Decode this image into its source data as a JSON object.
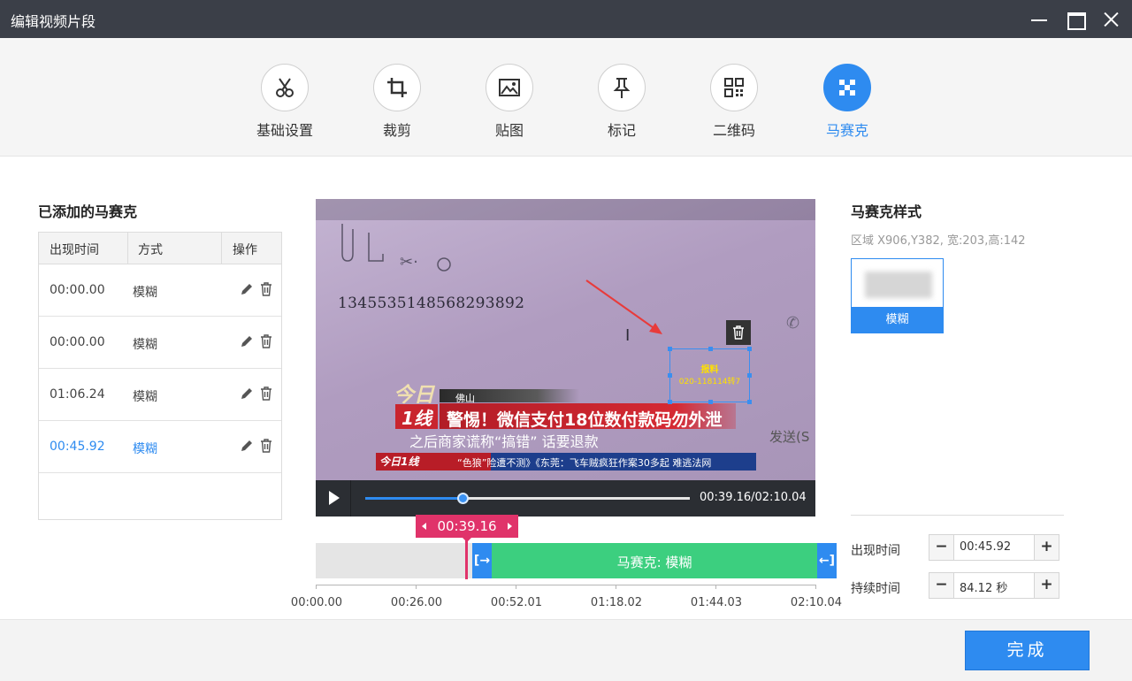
{
  "window": {
    "title": "编辑视频片段"
  },
  "toolbar": {
    "tools": [
      {
        "label": "基础设置",
        "icon": "scissors-icon"
      },
      {
        "label": "裁剪",
        "icon": "crop-icon"
      },
      {
        "label": "贴图",
        "icon": "image-icon"
      },
      {
        "label": "标记",
        "icon": "pin-icon"
      },
      {
        "label": "二维码",
        "icon": "qrcode-icon"
      },
      {
        "label": "马赛克",
        "icon": "mosaic-icon",
        "active": true
      }
    ]
  },
  "added": {
    "title": "已添加的马赛克",
    "headers": [
      "出现时间",
      "方式",
      "操作"
    ],
    "rows": [
      {
        "time": "00:00.00",
        "mode": "模糊"
      },
      {
        "time": "00:00.00",
        "mode": "模糊"
      },
      {
        "time": "01:06.24",
        "mode": "模糊"
      },
      {
        "time": "00:45.92",
        "mode": "模糊",
        "active": true
      }
    ]
  },
  "video": {
    "number_text": "13455351485682938​92",
    "selection_line1": "报料",
    "selection_line2": "020-118114转7",
    "city": "佛山",
    "logo_a": "今日",
    "logo_b": "1线",
    "headline": "警惕！微信支付18位数付款码勿外泄",
    "subline": "之后商家谎称“搞错” 话要退款",
    "ticker_logo": "今日1线",
    "ticker": "“色狼”险遭不测》《东莞：飞车贼疯狂作案30多起 难逃法网",
    "right_text": "发送(S",
    "time_display": "00:39.16/02:10.04",
    "progress": 0.3
  },
  "timeline": {
    "current": "00:39.16",
    "segment_label": "马赛克: 模糊",
    "ticks": [
      "00:00.00",
      "00:26.00",
      "00:52.01",
      "01:18.02",
      "01:44.03",
      "02:10.04"
    ]
  },
  "style": {
    "title": "马赛克样式",
    "region": "区域 X906,Y382, 宽:203,高:142",
    "card_label": "模糊",
    "appear_label": "出现时间",
    "appear_value": "00:45.92",
    "duration_label": "持续时间",
    "duration_value": "84.12 秒"
  },
  "footer": {
    "done_label": "完成"
  },
  "colors": {
    "accent": "#2e8bf0",
    "segment": "#3ccf7f",
    "playhead": "#e0336a",
    "titlebar": "#3b3f48"
  }
}
